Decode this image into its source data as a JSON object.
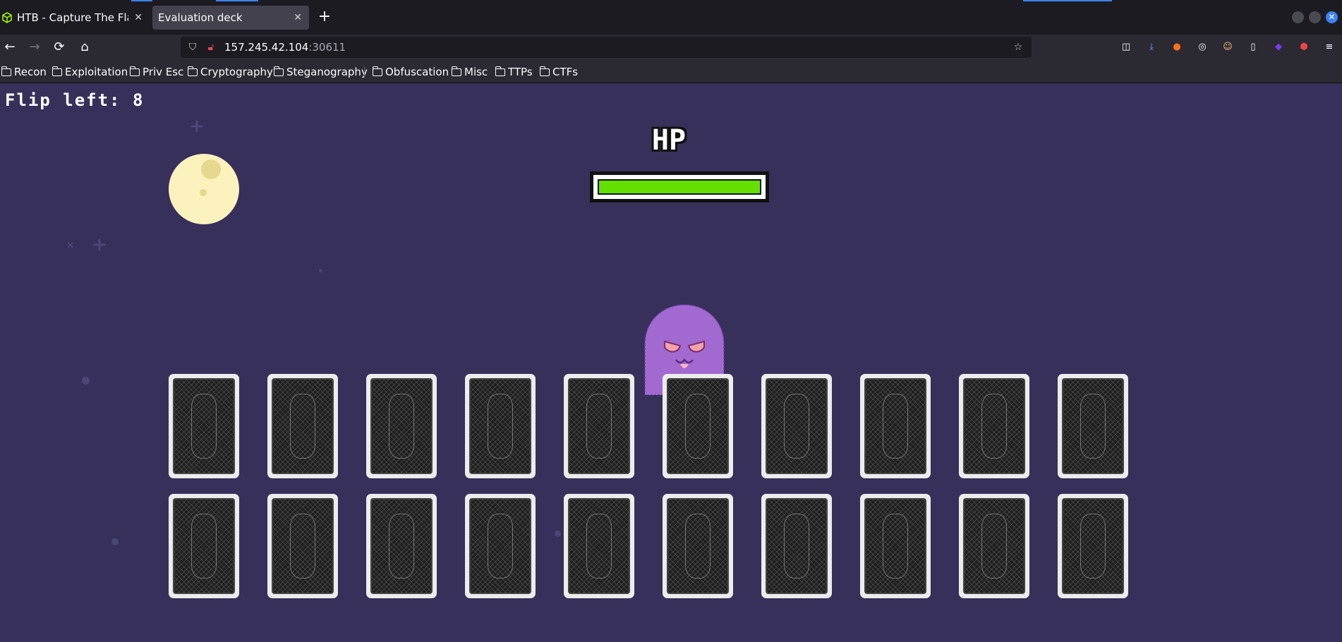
{
  "browser": {
    "tabs": [
      {
        "title": "HTB - Capture The Flag",
        "active": false
      },
      {
        "title": "Evaluation deck",
        "active": true
      }
    ],
    "url": {
      "host": "157.245.42.104",
      "port": ":30611"
    },
    "bookmarks": [
      "Recon",
      "Exploitation",
      "Priv Esc",
      "Cryptography",
      "Steganography",
      "Obfuscation",
      "Misc",
      "TTPs",
      "CTFs"
    ]
  },
  "game": {
    "flip_left_text": "Flip left: 8",
    "hp_label": "HP",
    "hp_fraction": 1.0,
    "card_rows": 2,
    "cards_per_row": 10
  },
  "colors": {
    "game_background": "#37305a",
    "hp_fill": "#63e000",
    "moon": "#fbf2bd",
    "ghost": "#a26ad0",
    "accent": "#3b82f6"
  }
}
